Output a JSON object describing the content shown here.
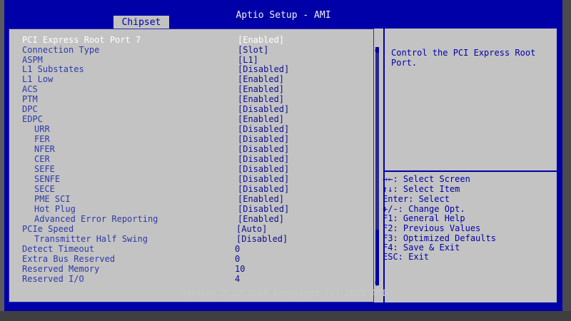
{
  "app": {
    "title": "Aptio Setup - AMI"
  },
  "tabs": [
    {
      "label": "Chipset"
    }
  ],
  "settings": [
    {
      "label": "PCI Express Root Port 7",
      "value": "[Enabled]"
    },
    {
      "label": "Connection Type",
      "value": "[Slot]"
    },
    {
      "label": "ASPM",
      "value": "[L1]"
    },
    {
      "label": "L1 Substates",
      "value": "[Disabled]"
    },
    {
      "label": "L1 Low",
      "value": "[Enabled]"
    },
    {
      "label": "ACS",
      "value": "[Enabled]"
    },
    {
      "label": "PTM",
      "value": "[Enabled]"
    },
    {
      "label": "DPC",
      "value": "[Disabled]"
    },
    {
      "label": "EDPC",
      "value": "[Enabled]"
    },
    {
      "label": "URR",
      "value": "[Disabled]"
    },
    {
      "label": "FER",
      "value": "[Disabled]"
    },
    {
      "label": "NFER",
      "value": "[Disabled]"
    },
    {
      "label": "CER",
      "value": "[Disabled]"
    },
    {
      "label": "SEFE",
      "value": "[Disabled]"
    },
    {
      "label": "SENFE",
      "value": "[Disabled]"
    },
    {
      "label": "SECE",
      "value": "[Disabled]"
    },
    {
      "label": "PME SCI",
      "value": "[Enabled]"
    },
    {
      "label": "Hot Plug",
      "value": "[Disabled]"
    },
    {
      "label": "Advanced Error Reporting",
      "value": "[Enabled]"
    },
    {
      "label": "PCIe Speed",
      "value": "[Auto]"
    },
    {
      "label": "Transmitter Half Swing",
      "value": "[Disabled]"
    },
    {
      "label": "Detect Timeout",
      "value": "0"
    },
    {
      "label": "Extra Bus Reserved",
      "value": "0"
    },
    {
      "label": "Reserved Memory",
      "value": "10"
    },
    {
      "label": "Reserved I/O",
      "value": "4"
    }
  ],
  "help": {
    "description": "Control the PCI Express Root Port.",
    "keys": [
      "→←: Select Screen",
      "↑↓: Select Item",
      "Enter: Select",
      "+/-: Change Opt.",
      "F1: General Help",
      "F2: Previous Values",
      "F3: Optimized Defaults",
      "F4: Save & Exit",
      "ESC: Exit"
    ]
  },
  "scrollbar": {
    "up_glyph": "▲",
    "down_glyph": "▼"
  },
  "footer": {
    "version": "Version 2.22.1288 Copyright (C) 2023 AMI"
  }
}
